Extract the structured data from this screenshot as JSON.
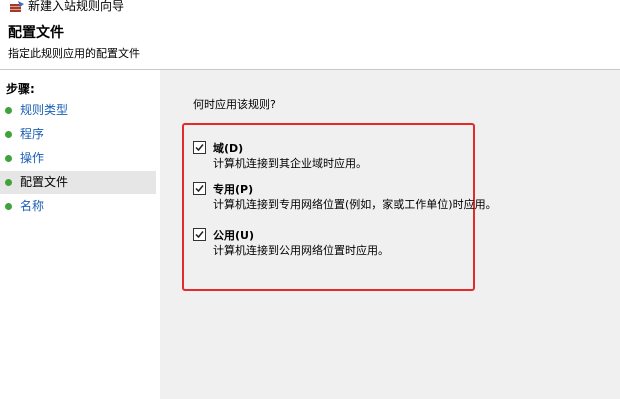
{
  "window": {
    "title": "新建入站规则向导"
  },
  "header": {
    "title": "配置文件",
    "subtitle": "指定此规则应用的配置文件"
  },
  "sidebar": {
    "steps_label": "步骤:",
    "items": [
      {
        "label": "规则类型"
      },
      {
        "label": "程序"
      },
      {
        "label": "操作"
      },
      {
        "label": "配置文件"
      },
      {
        "label": "名称"
      }
    ],
    "active_index": 3
  },
  "main": {
    "question": "何时应用该规则?",
    "options": [
      {
        "label": "域(D)",
        "description": "计算机连接到其企业域时应用。",
        "checked": true
      },
      {
        "label": "专用(P)",
        "description": "计算机连接到专用网络位置(例如，家或工作单位)时应用。",
        "checked": true
      },
      {
        "label": "公用(U)",
        "description": "计算机连接到公用网络位置时应用。",
        "checked": true
      }
    ]
  },
  "colors": {
    "highlight_border": "#e32b2b",
    "step_link": "#1a5fb4",
    "step_dot": "#3fa23a",
    "main_bg": "#f0f0f0"
  }
}
